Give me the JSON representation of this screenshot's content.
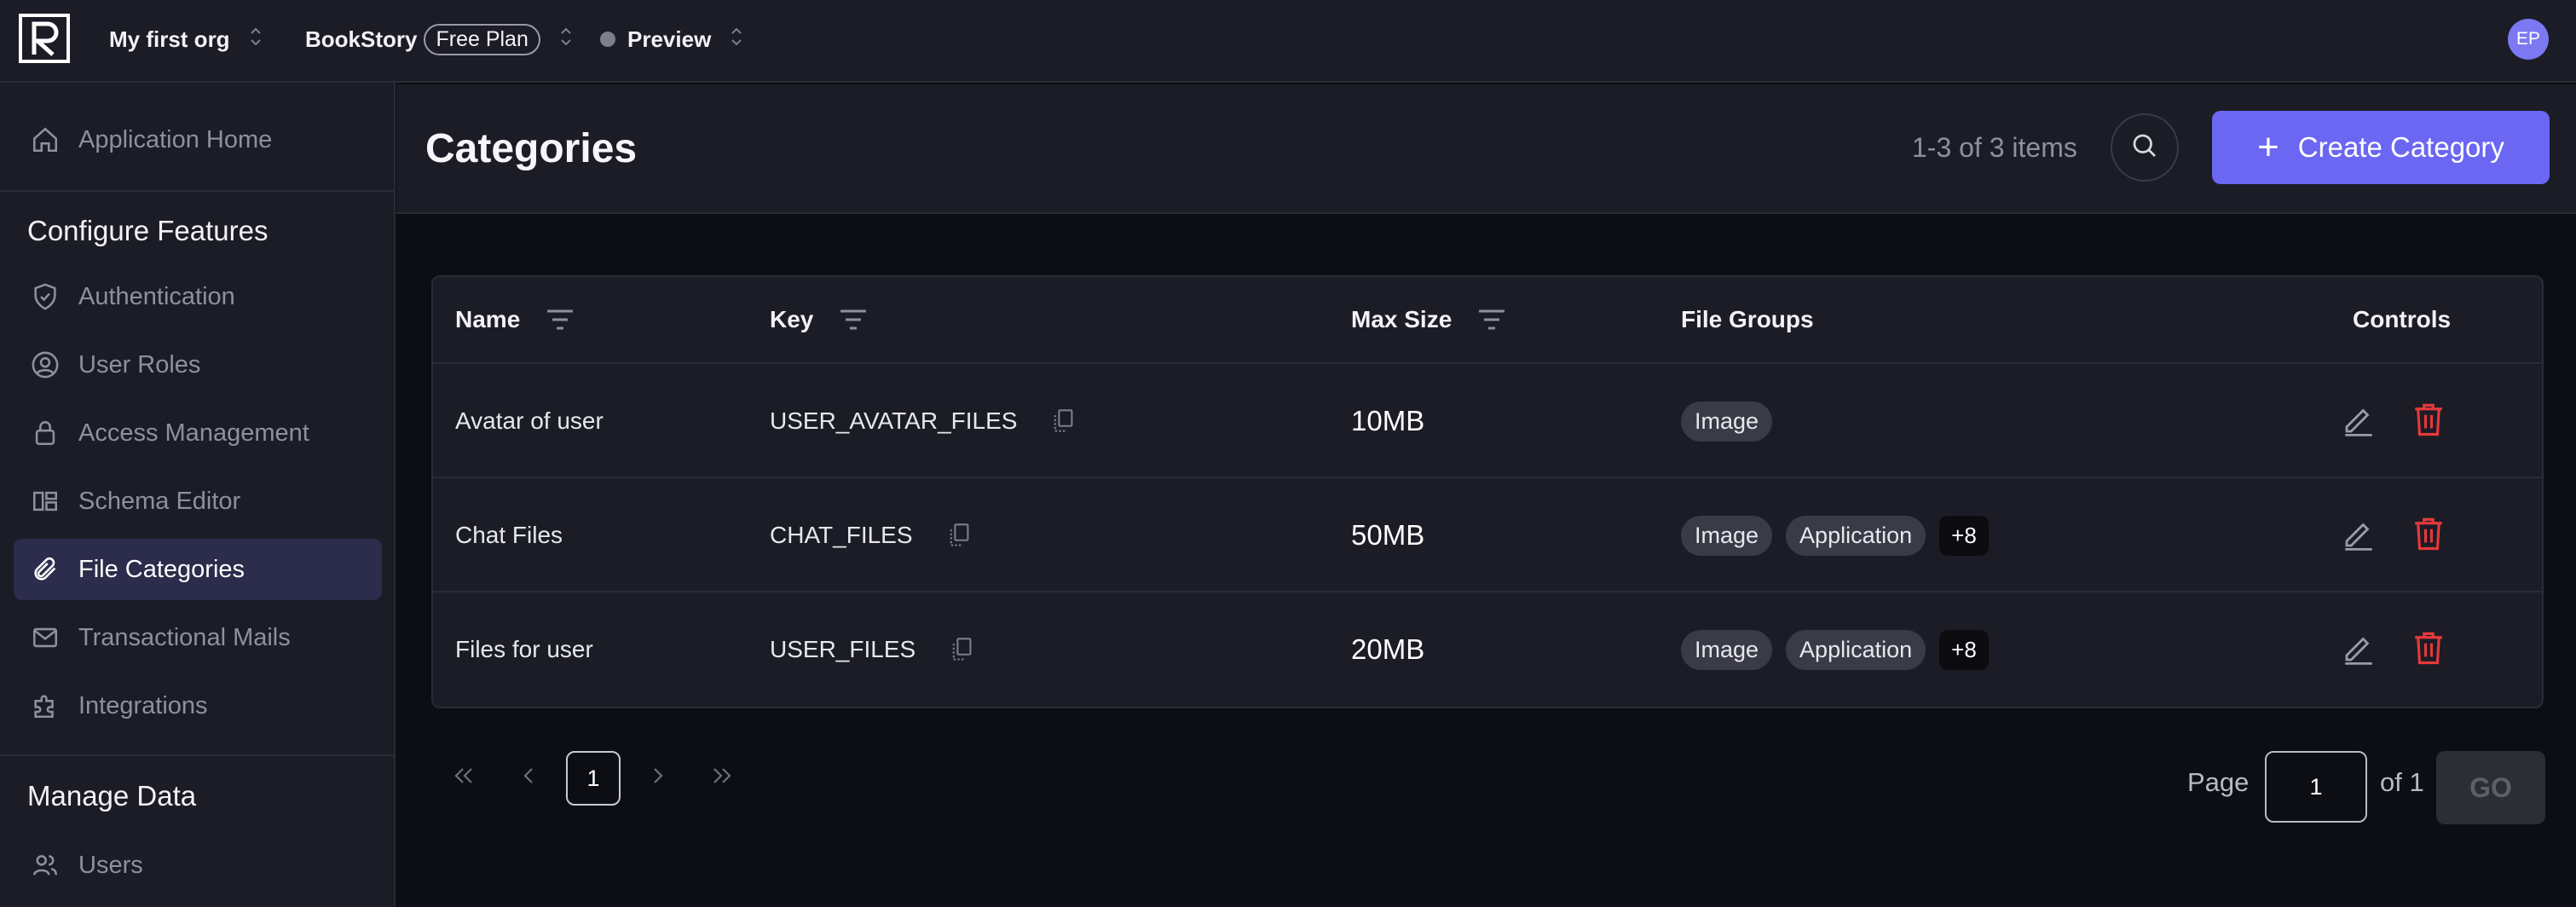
{
  "topbar": {
    "org": "My first org",
    "project": "BookStory",
    "plan": "Free Plan",
    "environment": "Preview",
    "avatar_initials": "EP"
  },
  "sidebar": {
    "home": "Application Home",
    "sections": [
      {
        "title": "Configure Features",
        "items": [
          {
            "label": "Authentication",
            "icon": "shield-check-icon"
          },
          {
            "label": "User Roles",
            "icon": "user-circle-icon"
          },
          {
            "label": "Access Management",
            "icon": "lock-icon"
          },
          {
            "label": "Schema Editor",
            "icon": "schema-icon"
          },
          {
            "label": "File Categories",
            "icon": "paperclip-icon",
            "active": true
          },
          {
            "label": "Transactional Mails",
            "icon": "mail-icon"
          },
          {
            "label": "Integrations",
            "icon": "puzzle-icon"
          }
        ]
      },
      {
        "title": "Manage Data",
        "items": [
          {
            "label": "Users",
            "icon": "users-icon"
          }
        ]
      }
    ]
  },
  "header": {
    "title": "Categories",
    "count": "1-3 of 3 items",
    "create_label": "Create Category",
    "accent": "#6b67f3"
  },
  "table": {
    "columns": [
      "Name",
      "Key",
      "Max Size",
      "File Groups",
      "Controls"
    ],
    "rows": [
      {
        "name": "Avatar of user",
        "key": "USER_AVATAR_FILES",
        "max_size": "10MB",
        "groups": [
          "Image"
        ],
        "more": ""
      },
      {
        "name": "Chat Files",
        "key": "CHAT_FILES",
        "max_size": "50MB",
        "groups": [
          "Image",
          "Application"
        ],
        "more": "+8"
      },
      {
        "name": "Files for user",
        "key": "USER_FILES",
        "max_size": "20MB",
        "groups": [
          "Image",
          "Application"
        ],
        "more": "+8"
      }
    ],
    "delete_color": "#e5393c"
  },
  "pagination": {
    "current": "1",
    "page_label": "Page",
    "page_value": "1",
    "of_label": "of 1",
    "go_label": "GO"
  }
}
